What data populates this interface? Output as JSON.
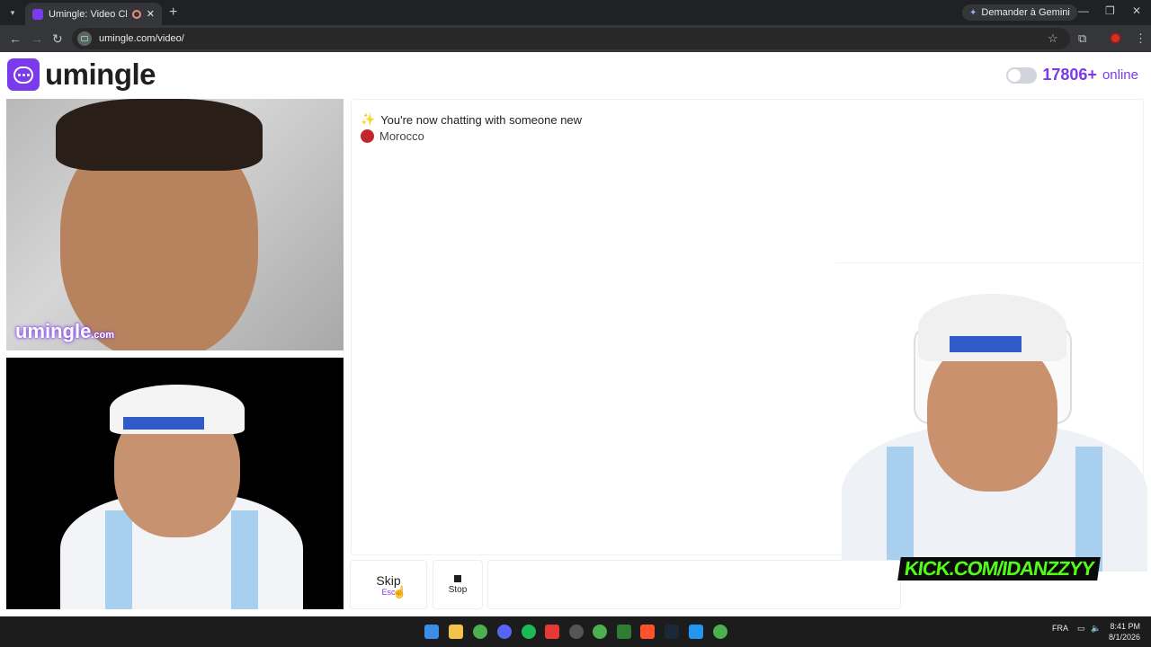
{
  "browser": {
    "tab_title": "Umingle: Video Chat with S",
    "new_tab": "+",
    "gemini_label": "Demander à Gemini",
    "url": "umingle.com/video/"
  },
  "header": {
    "logo_text": "umingle",
    "online_count": "17806+",
    "online_label": "online"
  },
  "video": {
    "watermark": "umingle",
    "watermark_suffix": ".com"
  },
  "chat": {
    "message_1": "You're now chatting with someone new",
    "country": "Morocco"
  },
  "controls": {
    "skip_label": "Skip",
    "skip_key": "Esc",
    "stop_label": "Stop"
  },
  "overlay": {
    "kick_text": "KICK.COM/IDANZZYY"
  },
  "taskbar": {
    "lang": "FRA",
    "time": "8:41 PM",
    "date": "8/1/2026"
  },
  "colors": {
    "brand": "#7c3aed",
    "kick": "#53fc18"
  }
}
